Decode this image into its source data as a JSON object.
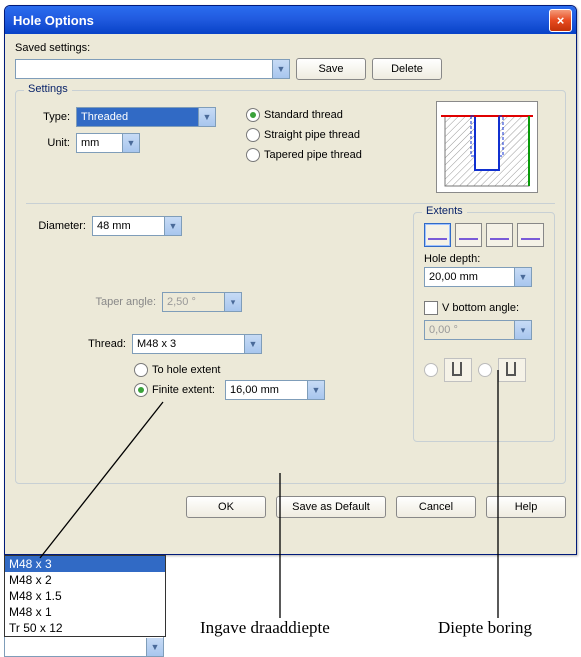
{
  "window": {
    "title": "Hole Options"
  },
  "saved": {
    "label": "Saved settings:",
    "value": "",
    "save": "Save",
    "delete": "Delete"
  },
  "settings": {
    "legend": "Settings",
    "type_label": "Type:",
    "type_value": "Threaded",
    "unit_label": "Unit:",
    "unit_value": "mm",
    "thread_std": "Standard thread",
    "thread_straight": "Straight pipe thread",
    "thread_tapered": "Tapered pipe thread",
    "diameter_label": "Diameter:",
    "diameter_value": "48 mm",
    "taper_label": "Taper angle:",
    "taper_value": "2,50 °",
    "thread_label": "Thread:",
    "thread_value": "M48 x 3",
    "to_hole_extent": "To hole extent",
    "finite_extent": "Finite extent:",
    "finite_value": "16,00 mm"
  },
  "extents": {
    "legend": "Extents",
    "hole_depth_label": "Hole depth:",
    "hole_depth_value": "20,00 mm",
    "v_bottom_label": "V bottom angle:",
    "v_bottom_value": "0,00 °"
  },
  "buttons": {
    "ok": "OK",
    "save_default": "Save as Default",
    "cancel": "Cancel",
    "help": "Help"
  },
  "thread_options": [
    "M48 x 3",
    "M48 x 2",
    "M48 x 1.5",
    "M48 x 1",
    "Tr 50 x 12"
  ],
  "annotations": {
    "draaddiepte": "Ingave draaddiepte",
    "diepteboring": "Diepte boring"
  }
}
